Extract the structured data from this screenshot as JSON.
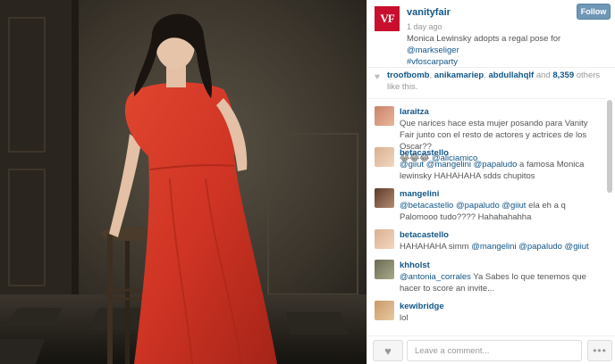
{
  "post": {
    "logo_text": "VF",
    "username": "vanityfair",
    "time_ago": "1 day ago",
    "caption_text": "Monica Lewinsky adopts a regal pose for ",
    "caption_mention": "@markseliger",
    "caption_hashtag": "#vfoscarparty",
    "follow_label": "Follow"
  },
  "likes": {
    "user1": "troofbomb",
    "user2": "anikamariep",
    "user3": "abdullahqlf",
    "count": "8,359",
    "sep1": ", ",
    "sep2": ", ",
    "sep3": " and ",
    "suffix": " others like this."
  },
  "comments": [
    {
      "user": "laraitza",
      "text": "Que narices hace esta mujer posando para Vanity Fair junto con el resto de actores y actrices de los Oscar??",
      "line2_prefix": "😂😂😂 ",
      "mention": "@aliciamico"
    },
    {
      "user": "betacastello",
      "mentions": "@giiut @mangelini @papaludo",
      "text": " a famosa Monica lewinsky HAHAHAHA sdds chupitos"
    },
    {
      "user": "mangelini",
      "mentions": "@betacastello @papaludo @giiut",
      "text": " ela eh a q Palomooo tudo???? Hahahahahha"
    },
    {
      "user": "betacastello",
      "text": "HAHAHAHA simm ",
      "mentions": "@mangelini @papaludo @giiut"
    },
    {
      "user": "khholst",
      "mentions": "@antonia_corrales",
      "text": " Ya Sabes lo que tenemos que hacer to score an invite..."
    },
    {
      "user": "kewibridge",
      "text": "lol"
    }
  ],
  "footer": {
    "comment_placeholder": "Leave a comment...",
    "heart_icon": "♥",
    "more_icon": "•••"
  },
  "colors": {
    "link": "#125688",
    "follow_button": "#6f97b6",
    "vf_red": "#c8102e",
    "dress_red": "#d8392b"
  }
}
